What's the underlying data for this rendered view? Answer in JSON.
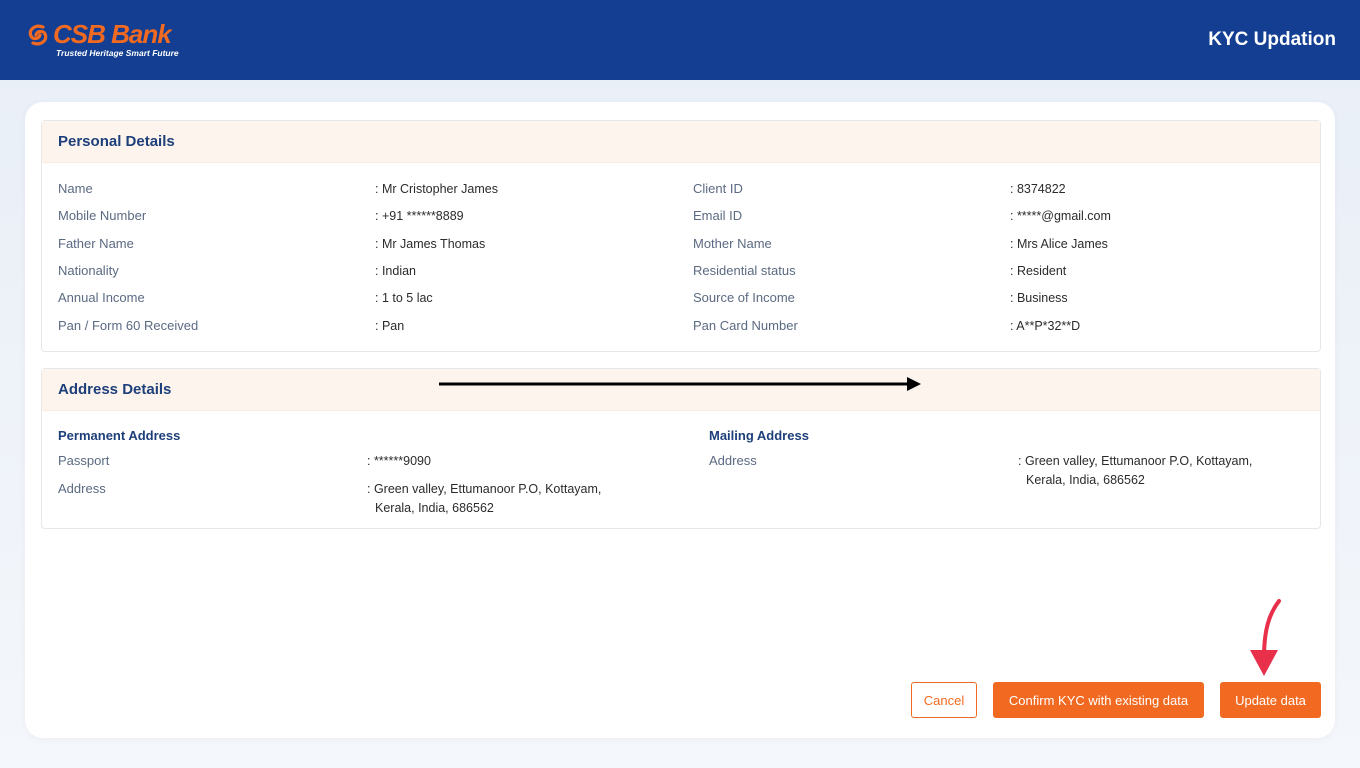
{
  "header": {
    "brand": "CSB Bank",
    "tagline": "Trusted Heritage Smart Future",
    "title": "KYC Updation",
    "brand_color": "#f26a21",
    "bar_color": "#133e91"
  },
  "personal": {
    "title": "Personal Details",
    "left": [
      {
        "label": "Name",
        "value": ": Mr Cristopher James"
      },
      {
        "label": "Mobile Number",
        "value": ": +91 ******8889"
      },
      {
        "label": "Father Name",
        "value": ": Mr James Thomas"
      },
      {
        "label": "Nationality",
        "value": ": Indian"
      },
      {
        "label": "Annual Income",
        "value": ": 1 to 5 lac"
      },
      {
        "label": "Pan / Form 60 Received",
        "value": ": Pan"
      }
    ],
    "right": [
      {
        "label": "Client ID",
        "value": ": 8374822"
      },
      {
        "label": "Email ID",
        "value": ": *****@gmail.com"
      },
      {
        "label": "Mother Name",
        "value": ": Mrs Alice James"
      },
      {
        "label": "Residential status",
        "value": ": Resident"
      },
      {
        "label": "Source of Income",
        "value": ": Business"
      },
      {
        "label": "Pan Card Number",
        "value": ": A**P*32**D"
      }
    ]
  },
  "address": {
    "title": "Address Details",
    "permanent": {
      "heading": "Permanent Address",
      "passport_label": "Passport",
      "passport_value": ": ******9090",
      "address_label": "Address",
      "address_line1": ": Green valley, Ettumanoor P.O, Kottayam,",
      "address_line2": "Kerala, India, 686562"
    },
    "mailing": {
      "heading": "Mailing Address",
      "address_label": "Address",
      "address_line1": ": Green valley, Ettumanoor P.O, Kottayam,",
      "address_line2": "Kerala, India, 686562"
    }
  },
  "actions": {
    "cancel": "Cancel",
    "confirm": "Confirm KYC with existing data",
    "update": "Update data"
  }
}
